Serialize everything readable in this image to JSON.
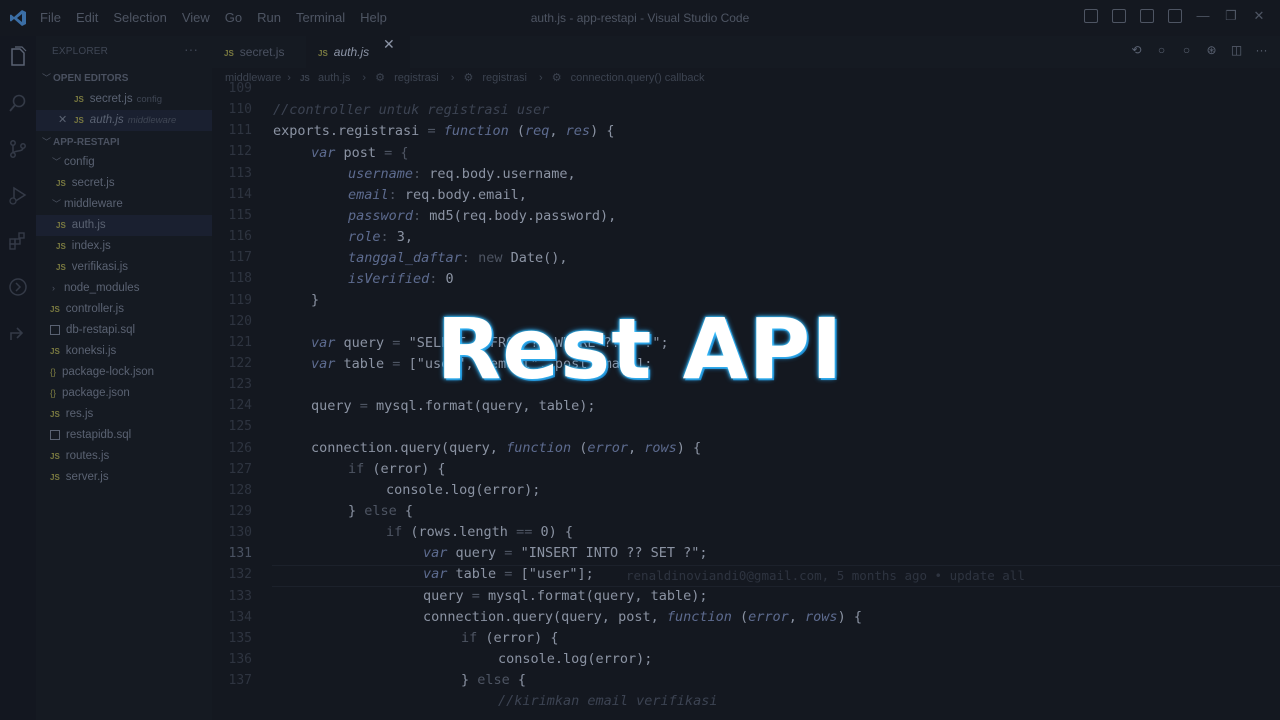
{
  "window": {
    "title": "auth.js - app-restapi - Visual Studio Code",
    "menu": [
      "File",
      "Edit",
      "Selection",
      "View",
      "Go",
      "Run",
      "Terminal",
      "Help"
    ]
  },
  "sidebar": {
    "header": "EXPLORER",
    "open_editors_label": "OPEN EDITORS",
    "open_editors": [
      {
        "name": "secret.js",
        "hint": "config"
      },
      {
        "name": "auth.js",
        "hint": "middleware"
      }
    ],
    "project_label": "APP-RESTAPI",
    "tree": [
      {
        "name": "config",
        "type": "folder"
      },
      {
        "name": "secret.js",
        "type": "js"
      },
      {
        "name": "middleware",
        "type": "folder"
      },
      {
        "name": "auth.js",
        "type": "js"
      },
      {
        "name": "index.js",
        "type": "js"
      },
      {
        "name": "verifikasi.js",
        "type": "js"
      },
      {
        "name": "node_modules",
        "type": "folder"
      },
      {
        "name": "controller.js",
        "type": "js"
      },
      {
        "name": "db-restapi.sql",
        "type": "sql"
      },
      {
        "name": "koneksi.js",
        "type": "js"
      },
      {
        "name": "package-lock.json",
        "type": "json"
      },
      {
        "name": "package.json",
        "type": "json"
      },
      {
        "name": "res.js",
        "type": "js"
      },
      {
        "name": "restapidb.sql",
        "type": "sql"
      },
      {
        "name": "routes.js",
        "type": "js"
      },
      {
        "name": "server.js",
        "type": "js"
      }
    ]
  },
  "tabs": [
    {
      "label": "secret.js"
    },
    {
      "label": "auth.js"
    }
  ],
  "breadcrumb": [
    "middleware",
    "auth.js",
    "registrasi",
    "registrasi",
    "connection.query() callback"
  ],
  "editor": {
    "line_numbers": [
      "109",
      "110",
      "111",
      "112",
      "113",
      "114",
      "115",
      "116",
      "117",
      "118",
      "119",
      "120",
      "121",
      "122",
      "123",
      "124",
      "125",
      "126",
      "127",
      "128",
      "129",
      "130",
      "131",
      "132",
      "133",
      "134",
      "135",
      "136",
      "137"
    ],
    "blame": "renaldinoviandi0@gmail.com, 5 months ago • update all"
  },
  "overlay": {
    "title": "Rest API"
  },
  "icons": {
    "logo": "vscode-logo-icon",
    "activity": [
      "explorer-icon",
      "search-icon",
      "source-control-icon",
      "run-debug-icon",
      "extensions-icon",
      "remote-icon",
      "share-icon"
    ]
  },
  "colors": {
    "background": "#141820",
    "overlay_text": "#ffffff",
    "overlay_glow": "#2aa7ff"
  }
}
